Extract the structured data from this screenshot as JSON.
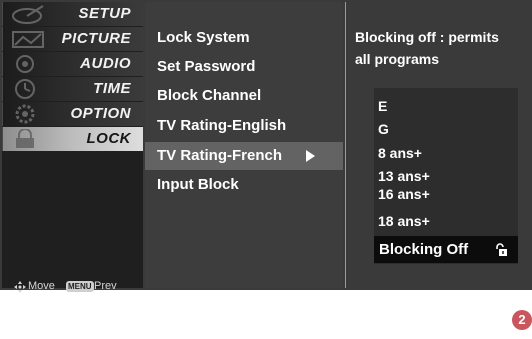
{
  "main_menu": {
    "items": [
      {
        "label": "SETUP",
        "icon": "satellite-dish-icon",
        "selected": false
      },
      {
        "label": "PICTURE",
        "icon": "picture-icon",
        "selected": false
      },
      {
        "label": "AUDIO",
        "icon": "speaker-icon",
        "selected": false
      },
      {
        "label": "TIME",
        "icon": "clock-icon",
        "selected": false
      },
      {
        "label": "OPTION",
        "icon": "option-icon",
        "selected": false
      },
      {
        "label": "LOCK",
        "icon": "lock-icon",
        "selected": true
      }
    ]
  },
  "hints": {
    "move_label": "Move",
    "menu_key_label": "MENU",
    "prev_label": "Prev"
  },
  "submenu": {
    "items": [
      {
        "label": "Lock System",
        "selected": false
      },
      {
        "label": "Set Password",
        "selected": false
      },
      {
        "label": "Block Channel",
        "selected": false
      },
      {
        "label": "TV Rating-English",
        "selected": false
      },
      {
        "label": "TV Rating-French",
        "selected": true
      },
      {
        "label": "Input Block",
        "selected": false
      }
    ]
  },
  "rating_panel": {
    "description_line1": "Blocking off : permits",
    "description_line2": "all programs",
    "ratings": [
      "E",
      "G",
      "8 ans+",
      "13 ans+",
      "16 ans+",
      "18 ans+"
    ],
    "blocking_label": "Blocking Off"
  },
  "page_number": "2",
  "colors": {
    "osd_background": "#3a3a3a",
    "selected_tab": "#dedede",
    "selected_submenu": "#636363",
    "page_badge": "#c9565c"
  }
}
